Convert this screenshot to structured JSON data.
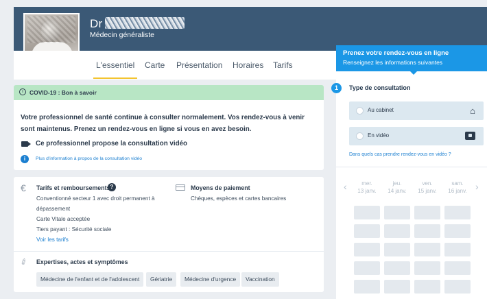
{
  "header": {
    "doctor_prefix": "Dr",
    "specialty": "Médecin généraliste"
  },
  "tabs": [
    {
      "label": "L'essentiel",
      "active": true
    },
    {
      "label": "Carte",
      "active": false
    },
    {
      "label": "Présentation",
      "active": false
    },
    {
      "label": "Horaires",
      "active": false
    },
    {
      "label": "Tarifs",
      "active": false
    }
  ],
  "booking": {
    "title": "Prenez votre rendez-vous en ligne",
    "subtitle": "Renseignez les informations suivantes",
    "step_number": "1",
    "step_title": "Type de consultation",
    "options": [
      {
        "label": "Au cabinet",
        "icon": "home-icon"
      },
      {
        "label": "En vidéo",
        "icon": "video-icon"
      }
    ],
    "help_link": "Dans quels cas prendre rendez-vous en vidéo ?",
    "days": [
      {
        "name": "mer.",
        "date": "13 janv."
      },
      {
        "name": "jeu.",
        "date": "14 janv."
      },
      {
        "name": "ven.",
        "date": "15 janv."
      },
      {
        "name": "sam.",
        "date": "16 janv."
      }
    ]
  },
  "covid": {
    "title": "COVID-19 : Bon à savoir",
    "message": "Votre professionnel de santé continue à consulter normalement. Vos rendez-vous à venir sont maintenus. Prenez un rendez-vous en ligne si vous en avez besoin.",
    "video_note": "Ce professionnel propose la consultation vidéo",
    "info_link": "Plus d'information à propos de la consultation vidéo"
  },
  "tarifs": {
    "title": "Tarifs et remboursements",
    "lines": [
      "Conventionné secteur 1 avec droit permanent à",
      "dépassement",
      "Carte Vitale acceptée",
      "Tiers payant : Sécurité sociale"
    ],
    "link": "Voir les tarifs"
  },
  "payment": {
    "title": "Moyens de paiement",
    "text": "Chèques, espèces et cartes bancaires"
  },
  "expertise": {
    "title": "Expertises, actes et symptômes",
    "chips": [
      "Médecine de l'enfant et de l'adolescent",
      "Gériatrie",
      "Médecine d'urgence",
      "Vaccination"
    ]
  },
  "colors": {
    "header_bg": "#3b5976",
    "accent_blue": "#1b97e6",
    "covid_green": "#b8e6c5",
    "tab_underline": "#f4c430"
  }
}
